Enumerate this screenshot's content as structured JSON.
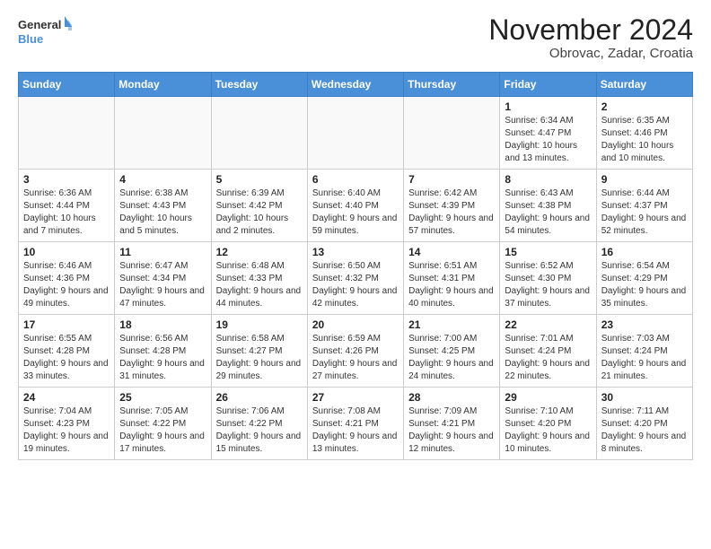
{
  "header": {
    "logo_line1": "General",
    "logo_line2": "Blue",
    "month": "November 2024",
    "location": "Obrovac, Zadar, Croatia"
  },
  "weekdays": [
    "Sunday",
    "Monday",
    "Tuesday",
    "Wednesday",
    "Thursday",
    "Friday",
    "Saturday"
  ],
  "weeks": [
    [
      {
        "day": "",
        "info": ""
      },
      {
        "day": "",
        "info": ""
      },
      {
        "day": "",
        "info": ""
      },
      {
        "day": "",
        "info": ""
      },
      {
        "day": "",
        "info": ""
      },
      {
        "day": "1",
        "info": "Sunrise: 6:34 AM\nSunset: 4:47 PM\nDaylight: 10 hours and 13 minutes."
      },
      {
        "day": "2",
        "info": "Sunrise: 6:35 AM\nSunset: 4:46 PM\nDaylight: 10 hours and 10 minutes."
      }
    ],
    [
      {
        "day": "3",
        "info": "Sunrise: 6:36 AM\nSunset: 4:44 PM\nDaylight: 10 hours and 7 minutes."
      },
      {
        "day": "4",
        "info": "Sunrise: 6:38 AM\nSunset: 4:43 PM\nDaylight: 10 hours and 5 minutes."
      },
      {
        "day": "5",
        "info": "Sunrise: 6:39 AM\nSunset: 4:42 PM\nDaylight: 10 hours and 2 minutes."
      },
      {
        "day": "6",
        "info": "Sunrise: 6:40 AM\nSunset: 4:40 PM\nDaylight: 9 hours and 59 minutes."
      },
      {
        "day": "7",
        "info": "Sunrise: 6:42 AM\nSunset: 4:39 PM\nDaylight: 9 hours and 57 minutes."
      },
      {
        "day": "8",
        "info": "Sunrise: 6:43 AM\nSunset: 4:38 PM\nDaylight: 9 hours and 54 minutes."
      },
      {
        "day": "9",
        "info": "Sunrise: 6:44 AM\nSunset: 4:37 PM\nDaylight: 9 hours and 52 minutes."
      }
    ],
    [
      {
        "day": "10",
        "info": "Sunrise: 6:46 AM\nSunset: 4:36 PM\nDaylight: 9 hours and 49 minutes."
      },
      {
        "day": "11",
        "info": "Sunrise: 6:47 AM\nSunset: 4:34 PM\nDaylight: 9 hours and 47 minutes."
      },
      {
        "day": "12",
        "info": "Sunrise: 6:48 AM\nSunset: 4:33 PM\nDaylight: 9 hours and 44 minutes."
      },
      {
        "day": "13",
        "info": "Sunrise: 6:50 AM\nSunset: 4:32 PM\nDaylight: 9 hours and 42 minutes."
      },
      {
        "day": "14",
        "info": "Sunrise: 6:51 AM\nSunset: 4:31 PM\nDaylight: 9 hours and 40 minutes."
      },
      {
        "day": "15",
        "info": "Sunrise: 6:52 AM\nSunset: 4:30 PM\nDaylight: 9 hours and 37 minutes."
      },
      {
        "day": "16",
        "info": "Sunrise: 6:54 AM\nSunset: 4:29 PM\nDaylight: 9 hours and 35 minutes."
      }
    ],
    [
      {
        "day": "17",
        "info": "Sunrise: 6:55 AM\nSunset: 4:28 PM\nDaylight: 9 hours and 33 minutes."
      },
      {
        "day": "18",
        "info": "Sunrise: 6:56 AM\nSunset: 4:28 PM\nDaylight: 9 hours and 31 minutes."
      },
      {
        "day": "19",
        "info": "Sunrise: 6:58 AM\nSunset: 4:27 PM\nDaylight: 9 hours and 29 minutes."
      },
      {
        "day": "20",
        "info": "Sunrise: 6:59 AM\nSunset: 4:26 PM\nDaylight: 9 hours and 27 minutes."
      },
      {
        "day": "21",
        "info": "Sunrise: 7:00 AM\nSunset: 4:25 PM\nDaylight: 9 hours and 24 minutes."
      },
      {
        "day": "22",
        "info": "Sunrise: 7:01 AM\nSunset: 4:24 PM\nDaylight: 9 hours and 22 minutes."
      },
      {
        "day": "23",
        "info": "Sunrise: 7:03 AM\nSunset: 4:24 PM\nDaylight: 9 hours and 21 minutes."
      }
    ],
    [
      {
        "day": "24",
        "info": "Sunrise: 7:04 AM\nSunset: 4:23 PM\nDaylight: 9 hours and 19 minutes."
      },
      {
        "day": "25",
        "info": "Sunrise: 7:05 AM\nSunset: 4:22 PM\nDaylight: 9 hours and 17 minutes."
      },
      {
        "day": "26",
        "info": "Sunrise: 7:06 AM\nSunset: 4:22 PM\nDaylight: 9 hours and 15 minutes."
      },
      {
        "day": "27",
        "info": "Sunrise: 7:08 AM\nSunset: 4:21 PM\nDaylight: 9 hours and 13 minutes."
      },
      {
        "day": "28",
        "info": "Sunrise: 7:09 AM\nSunset: 4:21 PM\nDaylight: 9 hours and 12 minutes."
      },
      {
        "day": "29",
        "info": "Sunrise: 7:10 AM\nSunset: 4:20 PM\nDaylight: 9 hours and 10 minutes."
      },
      {
        "day": "30",
        "info": "Sunrise: 7:11 AM\nSunset: 4:20 PM\nDaylight: 9 hours and 8 minutes."
      }
    ]
  ]
}
